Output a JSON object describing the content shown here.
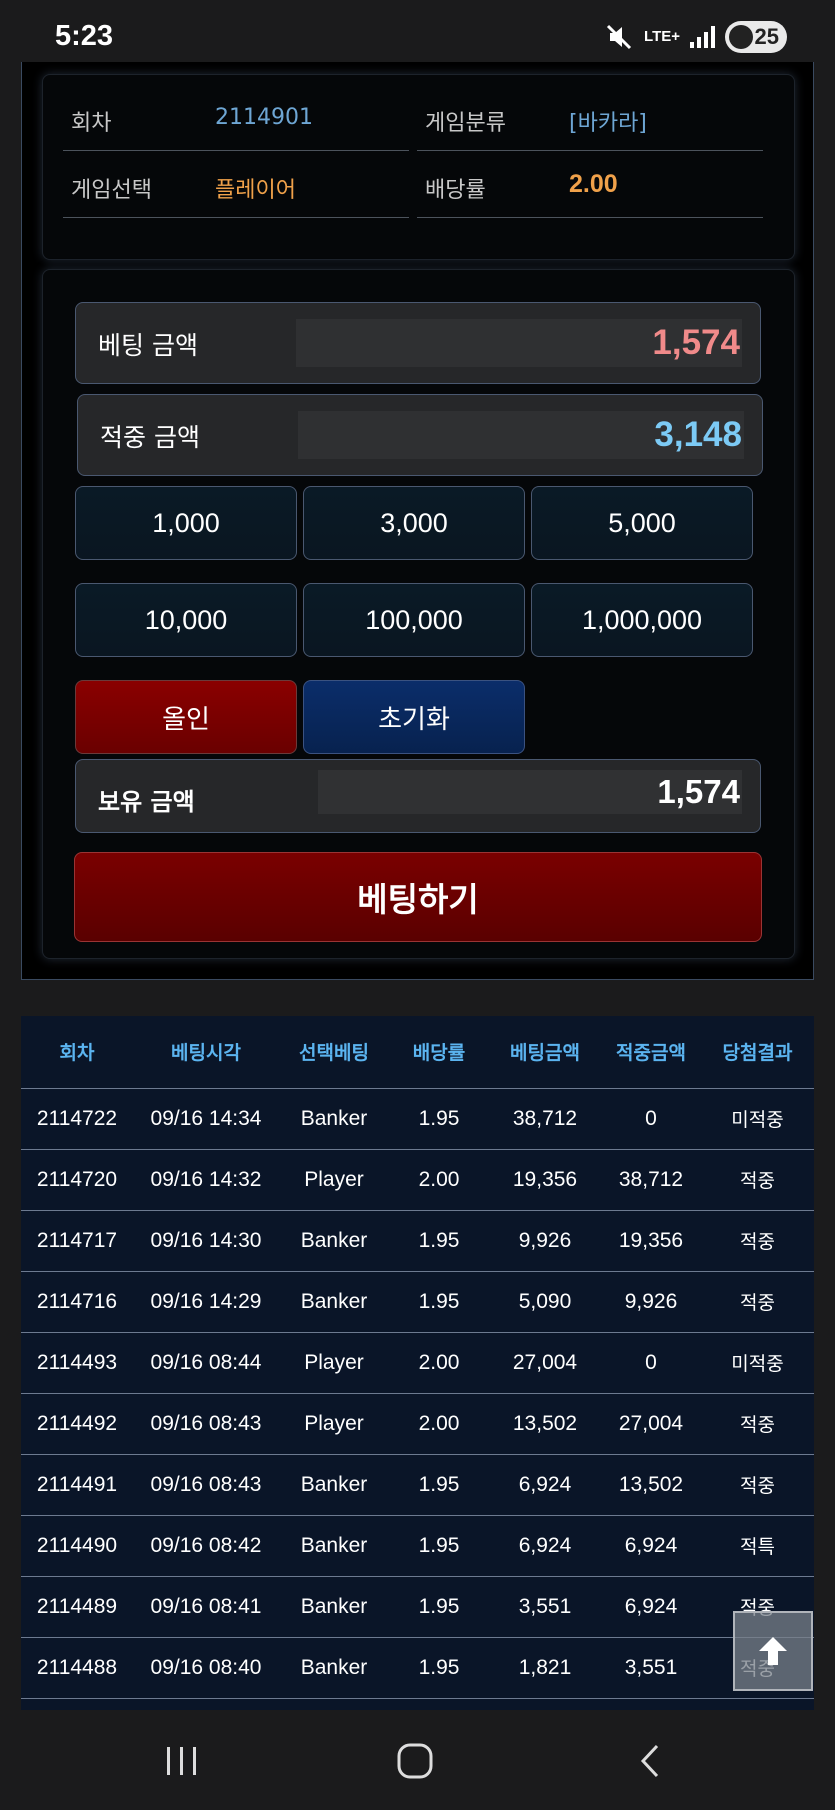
{
  "status_bar": {
    "time": "5:23",
    "network": "LTE+",
    "battery": "25",
    "icons": [
      "mute-icon",
      "signal-icon",
      "battery-icon"
    ]
  },
  "game_info": {
    "round_label": "회차",
    "round_value": "2114901",
    "category_label": "게임분류",
    "category_value": "[바카라]",
    "selection_label": "게임선택",
    "selection_value": "플레이어",
    "odds_label": "배당률",
    "odds_value": "2.00"
  },
  "bet_panel": {
    "bet_amount_label": "베팅 금액",
    "bet_amount_value": "1,574",
    "win_amount_label": "적중 금액",
    "win_amount_value": "3,148",
    "chips": [
      "1,000",
      "3,000",
      "5,000",
      "10,000",
      "100,000",
      "1,000,000"
    ],
    "allin_label": "올인",
    "reset_label": "초기화",
    "holding_label": "보유 금액",
    "holding_value": "1,574",
    "submit_label": "베팅하기"
  },
  "history": {
    "columns": [
      "회차",
      "베팅시각",
      "선택베팅",
      "배당률",
      "베팅금액",
      "적중금액",
      "당첨결과"
    ],
    "rows": [
      [
        "2114722",
        "09/16 14:34",
        "Banker",
        "1.95",
        "38,712",
        "0",
        "미적중"
      ],
      [
        "2114720",
        "09/16 14:32",
        "Player",
        "2.00",
        "19,356",
        "38,712",
        "적중"
      ],
      [
        "2114717",
        "09/16 14:30",
        "Banker",
        "1.95",
        "9,926",
        "19,356",
        "적중"
      ],
      [
        "2114716",
        "09/16 14:29",
        "Banker",
        "1.95",
        "5,090",
        "9,926",
        "적중"
      ],
      [
        "2114493",
        "09/16 08:44",
        "Player",
        "2.00",
        "27,004",
        "0",
        "미적중"
      ],
      [
        "2114492",
        "09/16 08:43",
        "Player",
        "2.00",
        "13,502",
        "27,004",
        "적중"
      ],
      [
        "2114491",
        "09/16 08:43",
        "Banker",
        "1.95",
        "6,924",
        "13,502",
        "적중"
      ],
      [
        "2114490",
        "09/16 08:42",
        "Banker",
        "1.95",
        "6,924",
        "6,924",
        "적특"
      ],
      [
        "2114489",
        "09/16 08:41",
        "Banker",
        "1.95",
        "3,551",
        "6,924",
        "적중"
      ],
      [
        "2114488",
        "09/16 08:40",
        "Banker",
        "1.95",
        "1,821",
        "3,551",
        "적중"
      ]
    ]
  },
  "colors": {
    "accent_blue": "#5bb4f0",
    "win_orange": "#f0a14a",
    "lose_pink": "#f08aa0",
    "bet_red": "#f08a8a",
    "hit_blue": "#7ccaf5"
  },
  "nav": {
    "icons": [
      "recents-icon",
      "home-icon",
      "back-icon"
    ]
  }
}
